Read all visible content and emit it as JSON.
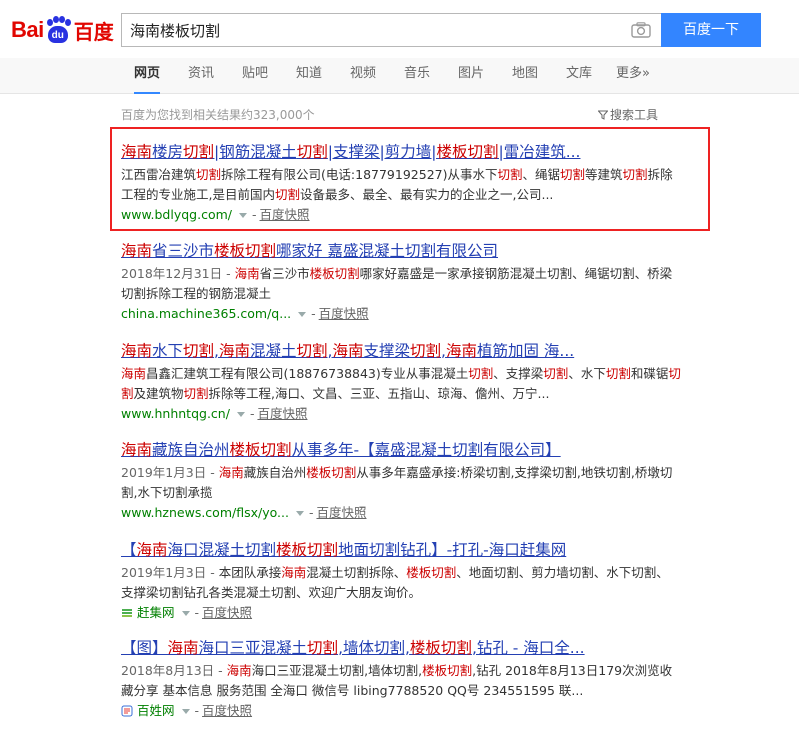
{
  "logo": {
    "bai": "Bai",
    "du": "du",
    "cn": "百度"
  },
  "search": {
    "query": "海南楼板切割",
    "button": "百度一下"
  },
  "nav": {
    "tabs": [
      {
        "label": "网页",
        "active": true
      },
      {
        "label": "资讯"
      },
      {
        "label": "贴吧"
      },
      {
        "label": "知道"
      },
      {
        "label": "视频"
      },
      {
        "label": "音乐"
      },
      {
        "label": "图片"
      },
      {
        "label": "地图"
      },
      {
        "label": "文库"
      },
      {
        "label": "更多»"
      }
    ]
  },
  "stats": "百度为您找到相关结果约323,000个",
  "tools_label": "搜索工具",
  "snapshot_label": "百度快照",
  "results": [
    {
      "title_parts": [
        {
          "t": "海南",
          "em": true
        },
        {
          "t": "楼房"
        },
        {
          "t": "切割",
          "em": true
        },
        {
          "t": "|钢筋混凝土"
        },
        {
          "t": "切割",
          "em": true
        },
        {
          "t": "|支撑梁|剪力墙|"
        },
        {
          "t": "楼板切割",
          "em": true
        },
        {
          "t": "|雷冶建筑..."
        }
      ],
      "abstract_parts": [
        {
          "t": "江西雷冶建筑"
        },
        {
          "t": "切割",
          "em": true
        },
        {
          "t": "拆除工程有限公司(电话:18779192527)从事水下"
        },
        {
          "t": "切割",
          "em": true
        },
        {
          "t": "、绳锯"
        },
        {
          "t": "切割",
          "em": true
        },
        {
          "t": "等建筑"
        },
        {
          "t": "切割",
          "em": true
        },
        {
          "t": "拆除工程的专业施工,是目前国内"
        },
        {
          "t": "切割",
          "em": true
        },
        {
          "t": "设备最多、最全、最有实力的企业之一,公司..."
        }
      ],
      "url": "www.bdlyqg.com/",
      "site_name": ""
    },
    {
      "title_parts": [
        {
          "t": "海南",
          "em": true
        },
        {
          "t": "省三沙市"
        },
        {
          "t": "楼板切割",
          "em": true
        },
        {
          "t": "哪家好  嘉盛混凝土切割有限公司"
        }
      ],
      "date": "2018年12月31日",
      "abstract_parts": [
        {
          "t": "海南",
          "em": true
        },
        {
          "t": "省三沙市"
        },
        {
          "t": "楼板切割",
          "em": true
        },
        {
          "t": "哪家好嘉盛是一家承接钢筋混凝土切割、绳锯切割、桥梁切割拆除工程的钢筋混凝土"
        }
      ],
      "url": "china.machine365.com/q...",
      "site_name": ""
    },
    {
      "title_parts": [
        {
          "t": "海南",
          "em": true
        },
        {
          "t": "水下"
        },
        {
          "t": "切割",
          "em": true
        },
        {
          "t": ","
        },
        {
          "t": "海南",
          "em": true
        },
        {
          "t": "混凝土"
        },
        {
          "t": "切割",
          "em": true
        },
        {
          "t": ","
        },
        {
          "t": "海南",
          "em": true
        },
        {
          "t": "支撑梁"
        },
        {
          "t": "切割",
          "em": true
        },
        {
          "t": ","
        },
        {
          "t": "海南",
          "em": true
        },
        {
          "t": "植筋加固  海..."
        }
      ],
      "abstract_parts": [
        {
          "t": "海南",
          "em": true
        },
        {
          "t": "昌鑫汇建筑工程有限公司(18876738843)专业从事混凝土"
        },
        {
          "t": "切割",
          "em": true
        },
        {
          "t": "、支撑梁"
        },
        {
          "t": "切割",
          "em": true
        },
        {
          "t": "、水下"
        },
        {
          "t": "切割",
          "em": true
        },
        {
          "t": "和碟锯"
        },
        {
          "t": "切割",
          "em": true
        },
        {
          "t": "及建筑物"
        },
        {
          "t": "切割",
          "em": true
        },
        {
          "t": "拆除等工程,海口、文昌、三亚、五指山、琼海、儋州、万宁..."
        }
      ],
      "url": "www.hnhntqg.cn/",
      "site_name": ""
    },
    {
      "title_parts": [
        {
          "t": "海南",
          "em": true
        },
        {
          "t": "藏族自治州"
        },
        {
          "t": "楼板切割",
          "em": true
        },
        {
          "t": "从事多年-【嘉盛混凝土切割有限公司】"
        }
      ],
      "date": "2019年1月3日",
      "abstract_parts": [
        {
          "t": "海南",
          "em": true
        },
        {
          "t": "藏族自治州"
        },
        {
          "t": "楼板切割",
          "em": true
        },
        {
          "t": "从事多年嘉盛承接:桥梁切割,支撑梁切割,地铁切割,桥墩切割,水下切割承揽"
        }
      ],
      "url": "www.hznews.com/flsx/yo...",
      "site_name": ""
    },
    {
      "title_parts": [
        {
          "t": "【"
        },
        {
          "t": "海南",
          "em": true
        },
        {
          "t": "海口混凝土切割"
        },
        {
          "t": "楼板切割",
          "em": true
        },
        {
          "t": "地面切割钻孔】-打孔-海口赶集网"
        }
      ],
      "date": "2019年1月3日",
      "abstract_parts": [
        {
          "t": "本团队承接"
        },
        {
          "t": "海南",
          "em": true
        },
        {
          "t": "混凝土切割拆除、"
        },
        {
          "t": "楼板切割",
          "em": true
        },
        {
          "t": "、地面切割、剪力墙切割、水下切割、支撑梁切割钻孔各类混凝土切割、欢迎广大朋友询价。"
        }
      ],
      "url": "",
      "site_name": "赶集网"
    },
    {
      "title_parts": [
        {
          "t": "【图】"
        },
        {
          "t": "海南",
          "em": true
        },
        {
          "t": "海口三亚混凝土"
        },
        {
          "t": "切割",
          "em": true
        },
        {
          "t": ",墙体切割,"
        },
        {
          "t": "楼板切割",
          "em": true
        },
        {
          "t": ",钻孔 - 海口全..."
        }
      ],
      "date": "2018年8月13日",
      "abstract_parts": [
        {
          "t": "海南",
          "em": true
        },
        {
          "t": "海口三亚混凝土切割,墙体切割,"
        },
        {
          "t": "楼板切割",
          "em": true
        },
        {
          "t": ",钻孔 2018年8月13日179次浏览收藏分享 基本信息 服务范围 全海口 微信号 libing7788520 QQ号 234551595 联..."
        }
      ],
      "url": "",
      "site_name": "百姓网"
    }
  ]
}
